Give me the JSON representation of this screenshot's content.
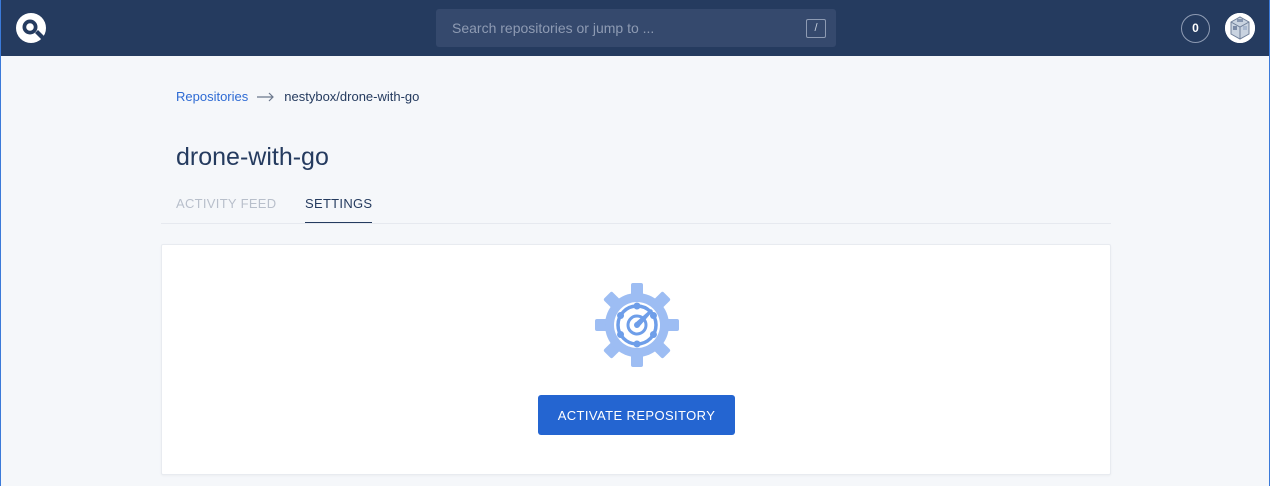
{
  "header": {
    "logo_icon": "drone-logo-icon",
    "search": {
      "placeholder": "Search repositories or jump to ...",
      "shortcut": "/"
    },
    "notification_count": "0",
    "avatar_icon": "user-avatar-icon"
  },
  "breadcrumb": {
    "root": "Repositories",
    "separator_icon": "arrow-right-icon",
    "current": "nestybox/drone-with-go"
  },
  "page": {
    "title": "drone-with-go",
    "tabs": [
      {
        "label": "ACTIVITY FEED",
        "active": false
      },
      {
        "label": "SETTINGS",
        "active": true
      }
    ]
  },
  "card": {
    "icon": "settings-gear-icon",
    "button_label": "ACTIVATE REPOSITORY"
  },
  "colors": {
    "topbar": "#253b5f",
    "primary": "#2465d1",
    "link": "#2e6bd4",
    "gear": "#8fb3f1"
  }
}
